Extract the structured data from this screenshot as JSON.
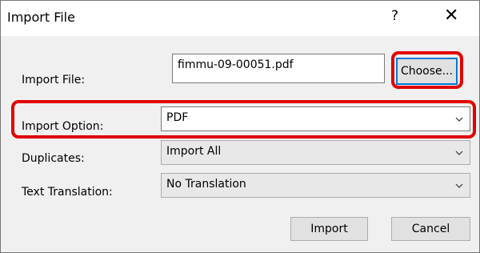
{
  "window": {
    "title": "Import File",
    "help_symbol": "?",
    "close_symbol": "✕"
  },
  "import_file": {
    "label": "Import File:",
    "value": "fimmu-09-00051.pdf",
    "choose_label": "Choose..."
  },
  "import_option": {
    "label": "Import Option:",
    "selected": "PDF"
  },
  "duplicates": {
    "label": "Duplicates:",
    "selected": "Import All"
  },
  "text_translation": {
    "label": "Text Translation:",
    "selected": "No Translation"
  },
  "buttons": {
    "import_label": "Import",
    "cancel_label": "Cancel"
  },
  "colors": {
    "highlight": "#e00000",
    "focus_border": "#0078d7",
    "dialog_bg": "#f0f0f0"
  }
}
